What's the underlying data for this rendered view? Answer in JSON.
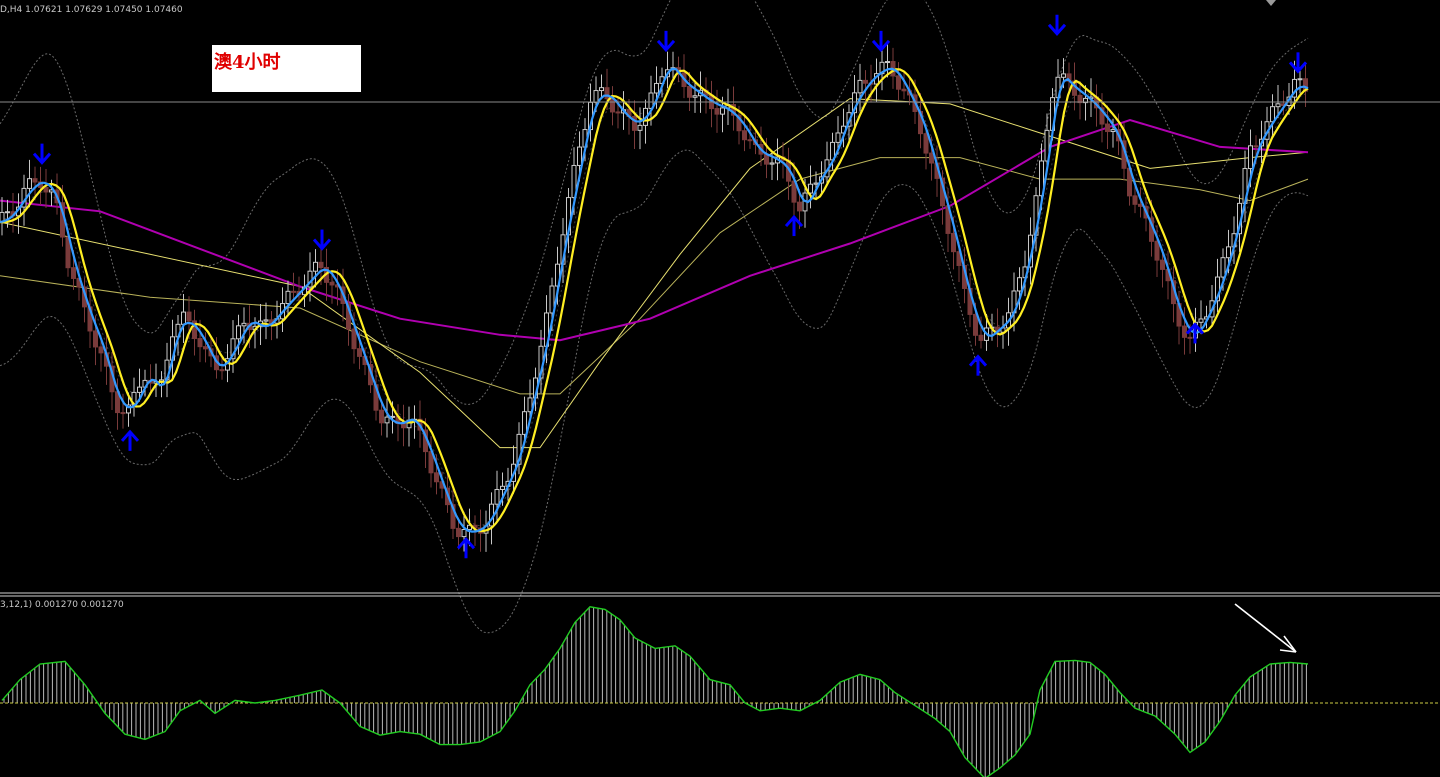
{
  "header": {
    "symbol_info": "D,H4  1.07621 1.07629 1.07450 1.07460",
    "oscillator_info": "3,12,1) 0.001270 0.001270"
  },
  "annotation": {
    "title": "澳4小时"
  },
  "colors": {
    "background": "#000000",
    "bull_candle": "#c8c8c8",
    "bear_candle": "#7a3b3b",
    "fast_ma": "#3399ff",
    "slow_ma": "#ffee22",
    "long_ma": "#b000b0",
    "bollinger": "#6a6a6a",
    "thin_ma": "#e8e070",
    "arrow": "#0000ff",
    "oscillator_line": "#22cc22",
    "oscillator_zero": "#cccc44",
    "hint_arrow": "#ffffff"
  },
  "chart_data": [
    {
      "type": "candlestick",
      "price_level": 1.0746,
      "price_path": [
        [
          0,
          0.62
        ],
        [
          12,
          0.64
        ],
        [
          25,
          0.68
        ],
        [
          40,
          0.7
        ],
        [
          55,
          0.66
        ],
        [
          68,
          0.55
        ],
        [
          85,
          0.45
        ],
        [
          100,
          0.38
        ],
        [
          115,
          0.28
        ],
        [
          130,
          0.27
        ],
        [
          145,
          0.34
        ],
        [
          160,
          0.3
        ],
        [
          172,
          0.42
        ],
        [
          185,
          0.44
        ],
        [
          200,
          0.4
        ],
        [
          215,
          0.34
        ],
        [
          230,
          0.38
        ],
        [
          245,
          0.44
        ],
        [
          262,
          0.42
        ],
        [
          280,
          0.46
        ],
        [
          300,
          0.5
        ],
        [
          320,
          0.54
        ],
        [
          335,
          0.5
        ],
        [
          350,
          0.42
        ],
        [
          365,
          0.34
        ],
        [
          380,
          0.26
        ],
        [
          395,
          0.24
        ],
        [
          410,
          0.26
        ],
        [
          425,
          0.2
        ],
        [
          440,
          0.12
        ],
        [
          455,
          0.05
        ],
        [
          470,
          0.04
        ],
        [
          485,
          0.06
        ],
        [
          500,
          0.12
        ],
        [
          515,
          0.18
        ],
        [
          530,
          0.3
        ],
        [
          545,
          0.42
        ],
        [
          560,
          0.58
        ],
        [
          575,
          0.72
        ],
        [
          590,
          0.85
        ],
        [
          605,
          0.86
        ],
        [
          620,
          0.82
        ],
        [
          635,
          0.8
        ],
        [
          650,
          0.84
        ],
        [
          665,
          0.92
        ],
        [
          680,
          0.88
        ],
        [
          695,
          0.86
        ],
        [
          710,
          0.84
        ],
        [
          725,
          0.83
        ],
        [
          740,
          0.8
        ],
        [
          755,
          0.75
        ],
        [
          770,
          0.74
        ],
        [
          785,
          0.72
        ],
        [
          800,
          0.64
        ],
        [
          815,
          0.7
        ],
        [
          830,
          0.74
        ],
        [
          845,
          0.82
        ],
        [
          860,
          0.87
        ],
        [
          875,
          0.9
        ],
        [
          890,
          0.91
        ],
        [
          905,
          0.86
        ],
        [
          920,
          0.8
        ],
        [
          935,
          0.7
        ],
        [
          950,
          0.6
        ],
        [
          965,
          0.48
        ],
        [
          980,
          0.4
        ],
        [
          995,
          0.42
        ],
        [
          1010,
          0.45
        ],
        [
          1025,
          0.55
        ],
        [
          1040,
          0.7
        ],
        [
          1055,
          0.9
        ],
        [
          1070,
          0.87
        ],
        [
          1085,
          0.85
        ],
        [
          1100,
          0.82
        ],
        [
          1115,
          0.78
        ],
        [
          1130,
          0.68
        ],
        [
          1145,
          0.62
        ],
        [
          1160,
          0.55
        ],
        [
          1175,
          0.45
        ],
        [
          1190,
          0.4
        ],
        [
          1205,
          0.45
        ],
        [
          1220,
          0.52
        ],
        [
          1235,
          0.62
        ],
        [
          1250,
          0.75
        ],
        [
          1265,
          0.8
        ],
        [
          1280,
          0.84
        ],
        [
          1295,
          0.88
        ],
        [
          1308,
          0.86
        ]
      ],
      "long_ma": [
        [
          0,
          0.66
        ],
        [
          100,
          0.64
        ],
        [
          200,
          0.57
        ],
        [
          300,
          0.5
        ],
        [
          400,
          0.44
        ],
        [
          500,
          0.41
        ],
        [
          560,
          0.4
        ],
        [
          650,
          0.44
        ],
        [
          750,
          0.52
        ],
        [
          850,
          0.58
        ],
        [
          950,
          0.65
        ],
        [
          1050,
          0.76
        ],
        [
          1130,
          0.81
        ],
        [
          1220,
          0.76
        ],
        [
          1308,
          0.75
        ]
      ],
      "thin_ma_1": [
        [
          0,
          0.62
        ],
        [
          150,
          0.56
        ],
        [
          300,
          0.5
        ],
        [
          420,
          0.34
        ],
        [
          500,
          0.2
        ],
        [
          540,
          0.2
        ],
        [
          600,
          0.36
        ],
        [
          680,
          0.56
        ],
        [
          750,
          0.72
        ],
        [
          850,
          0.85
        ],
        [
          950,
          0.84
        ],
        [
          1050,
          0.78
        ],
        [
          1150,
          0.72
        ],
        [
          1250,
          0.74
        ],
        [
          1308,
          0.75
        ]
      ],
      "thin_ma_2": [
        [
          0,
          0.52
        ],
        [
          150,
          0.48
        ],
        [
          300,
          0.46
        ],
        [
          420,
          0.36
        ],
        [
          520,
          0.3
        ],
        [
          560,
          0.3
        ],
        [
          640,
          0.44
        ],
        [
          720,
          0.6
        ],
        [
          800,
          0.7
        ],
        [
          880,
          0.74
        ],
        [
          960,
          0.74
        ],
        [
          1040,
          0.7
        ],
        [
          1120,
          0.7
        ],
        [
          1200,
          0.68
        ],
        [
          1250,
          0.66
        ],
        [
          1308,
          0.7
        ]
      ],
      "arrows": [
        {
          "x": 42,
          "price_level": 0.74,
          "direction": "down"
        },
        {
          "x": 130,
          "price_level": 0.22,
          "direction": "up"
        },
        {
          "x": 322,
          "price_level": 0.58,
          "direction": "down"
        },
        {
          "x": 466,
          "price_level": 0.02,
          "direction": "up"
        },
        {
          "x": 666,
          "price_level": 0.95,
          "direction": "down"
        },
        {
          "x": 794,
          "price_level": 0.62,
          "direction": "up"
        },
        {
          "x": 881,
          "price_level": 0.95,
          "direction": "down"
        },
        {
          "x": 978,
          "price_level": 0.36,
          "direction": "up"
        },
        {
          "x": 1057,
          "price_level": 0.98,
          "direction": "down"
        },
        {
          "x": 1195,
          "price_level": 0.42,
          "direction": "up"
        },
        {
          "x": 1298,
          "price_level": 0.91,
          "direction": "down"
        }
      ]
    },
    {
      "type": "histogram",
      "zero_level": 0,
      "series": [
        [
          2,
          0.05
        ],
        [
          20,
          0.45
        ],
        [
          40,
          0.75
        ],
        [
          65,
          0.8
        ],
        [
          85,
          0.35
        ],
        [
          105,
          -0.2
        ],
        [
          125,
          -0.6
        ],
        [
          145,
          -0.7
        ],
        [
          165,
          -0.55
        ],
        [
          180,
          -0.15
        ],
        [
          200,
          0.05
        ],
        [
          215,
          -0.2
        ],
        [
          235,
          0.05
        ],
        [
          255,
          0.0
        ],
        [
          275,
          0.05
        ],
        [
          300,
          0.15
        ],
        [
          322,
          0.25
        ],
        [
          340,
          0.0
        ],
        [
          360,
          -0.45
        ],
        [
          380,
          -0.62
        ],
        [
          400,
          -0.55
        ],
        [
          420,
          -0.6
        ],
        [
          440,
          -0.8
        ],
        [
          460,
          -0.8
        ],
        [
          480,
          -0.75
        ],
        [
          500,
          -0.55
        ],
        [
          515,
          -0.15
        ],
        [
          530,
          0.35
        ],
        [
          545,
          0.65
        ],
        [
          560,
          1.05
        ],
        [
          575,
          1.55
        ],
        [
          590,
          1.85
        ],
        [
          605,
          1.8
        ],
        [
          620,
          1.6
        ],
        [
          635,
          1.25
        ],
        [
          655,
          1.05
        ],
        [
          675,
          1.1
        ],
        [
          690,
          0.9
        ],
        [
          710,
          0.45
        ],
        [
          730,
          0.35
        ],
        [
          745,
          0.0
        ],
        [
          760,
          -0.15
        ],
        [
          780,
          -0.1
        ],
        [
          800,
          -0.15
        ],
        [
          820,
          0.05
        ],
        [
          840,
          0.4
        ],
        [
          860,
          0.55
        ],
        [
          880,
          0.45
        ],
        [
          895,
          0.2
        ],
        [
          915,
          -0.05
        ],
        [
          935,
          -0.3
        ],
        [
          950,
          -0.55
        ],
        [
          965,
          -1.05
        ],
        [
          985,
          -1.45
        ],
        [
          1000,
          -1.25
        ],
        [
          1015,
          -1.0
        ],
        [
          1030,
          -0.6
        ],
        [
          1040,
          0.25
        ],
        [
          1055,
          0.8
        ],
        [
          1075,
          0.82
        ],
        [
          1090,
          0.78
        ],
        [
          1105,
          0.55
        ],
        [
          1120,
          0.2
        ],
        [
          1135,
          -0.1
        ],
        [
          1155,
          -0.25
        ],
        [
          1175,
          -0.6
        ],
        [
          1190,
          -0.95
        ],
        [
          1205,
          -0.75
        ],
        [
          1220,
          -0.35
        ],
        [
          1235,
          0.15
        ],
        [
          1250,
          0.5
        ],
        [
          1270,
          0.75
        ],
        [
          1290,
          0.78
        ],
        [
          1308,
          0.75
        ]
      ]
    }
  ]
}
